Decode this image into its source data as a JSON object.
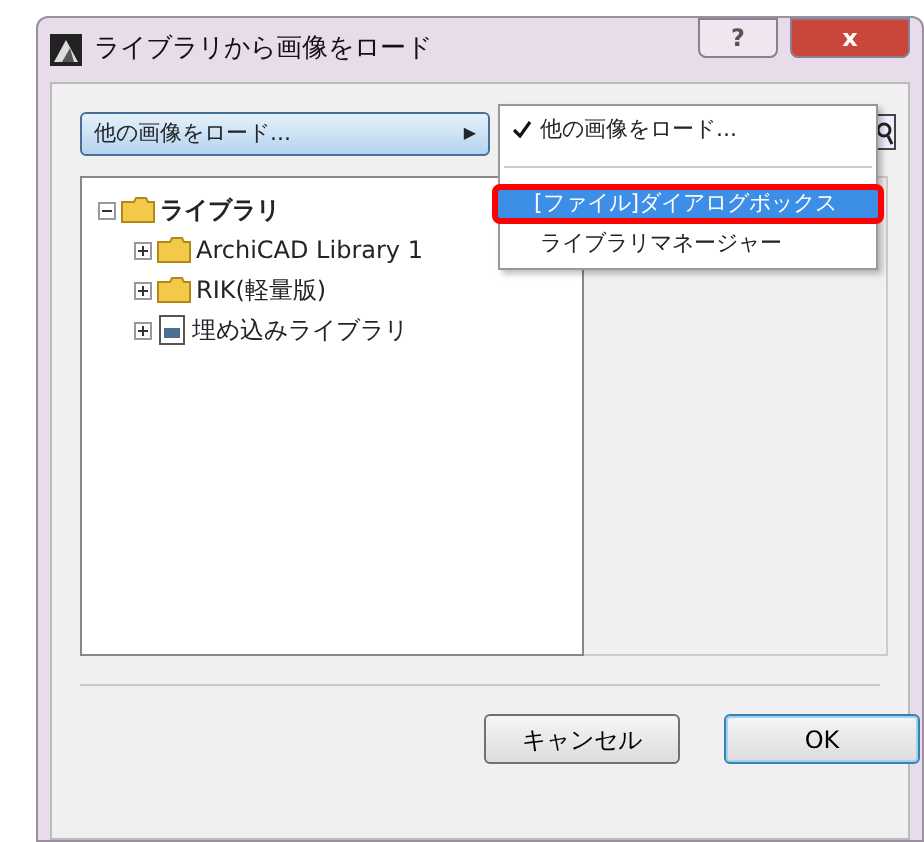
{
  "window": {
    "title": "ライブラリから画像をロード",
    "help_button": "?",
    "close_button": "x"
  },
  "source_dropdown": {
    "value": "他の画像をロード...",
    "arrow": "▶"
  },
  "source_menu": {
    "items": [
      {
        "label": "他の画像をロード...",
        "checked": true,
        "selected": false
      },
      {
        "label": "[ファイル]ダイアログボックス",
        "checked": false,
        "selected": true
      },
      {
        "label": "ライブラリマネージャー",
        "checked": false,
        "selected": false
      }
    ]
  },
  "tree": [
    {
      "label": "ライブラリ",
      "kind": "folder",
      "expanded": true,
      "children": [
        {
          "label": "ArchiCAD Library 1",
          "kind": "folder",
          "expanded": false
        },
        {
          "label": "RIK(軽量版)",
          "kind": "folder",
          "expanded": false
        },
        {
          "label": "埋め込みライブラリ",
          "kind": "document",
          "expanded": false
        }
      ]
    }
  ],
  "buttons": [
    {
      "label": "キャンセル",
      "default": false
    },
    {
      "label": "OK",
      "default": true
    }
  ]
}
